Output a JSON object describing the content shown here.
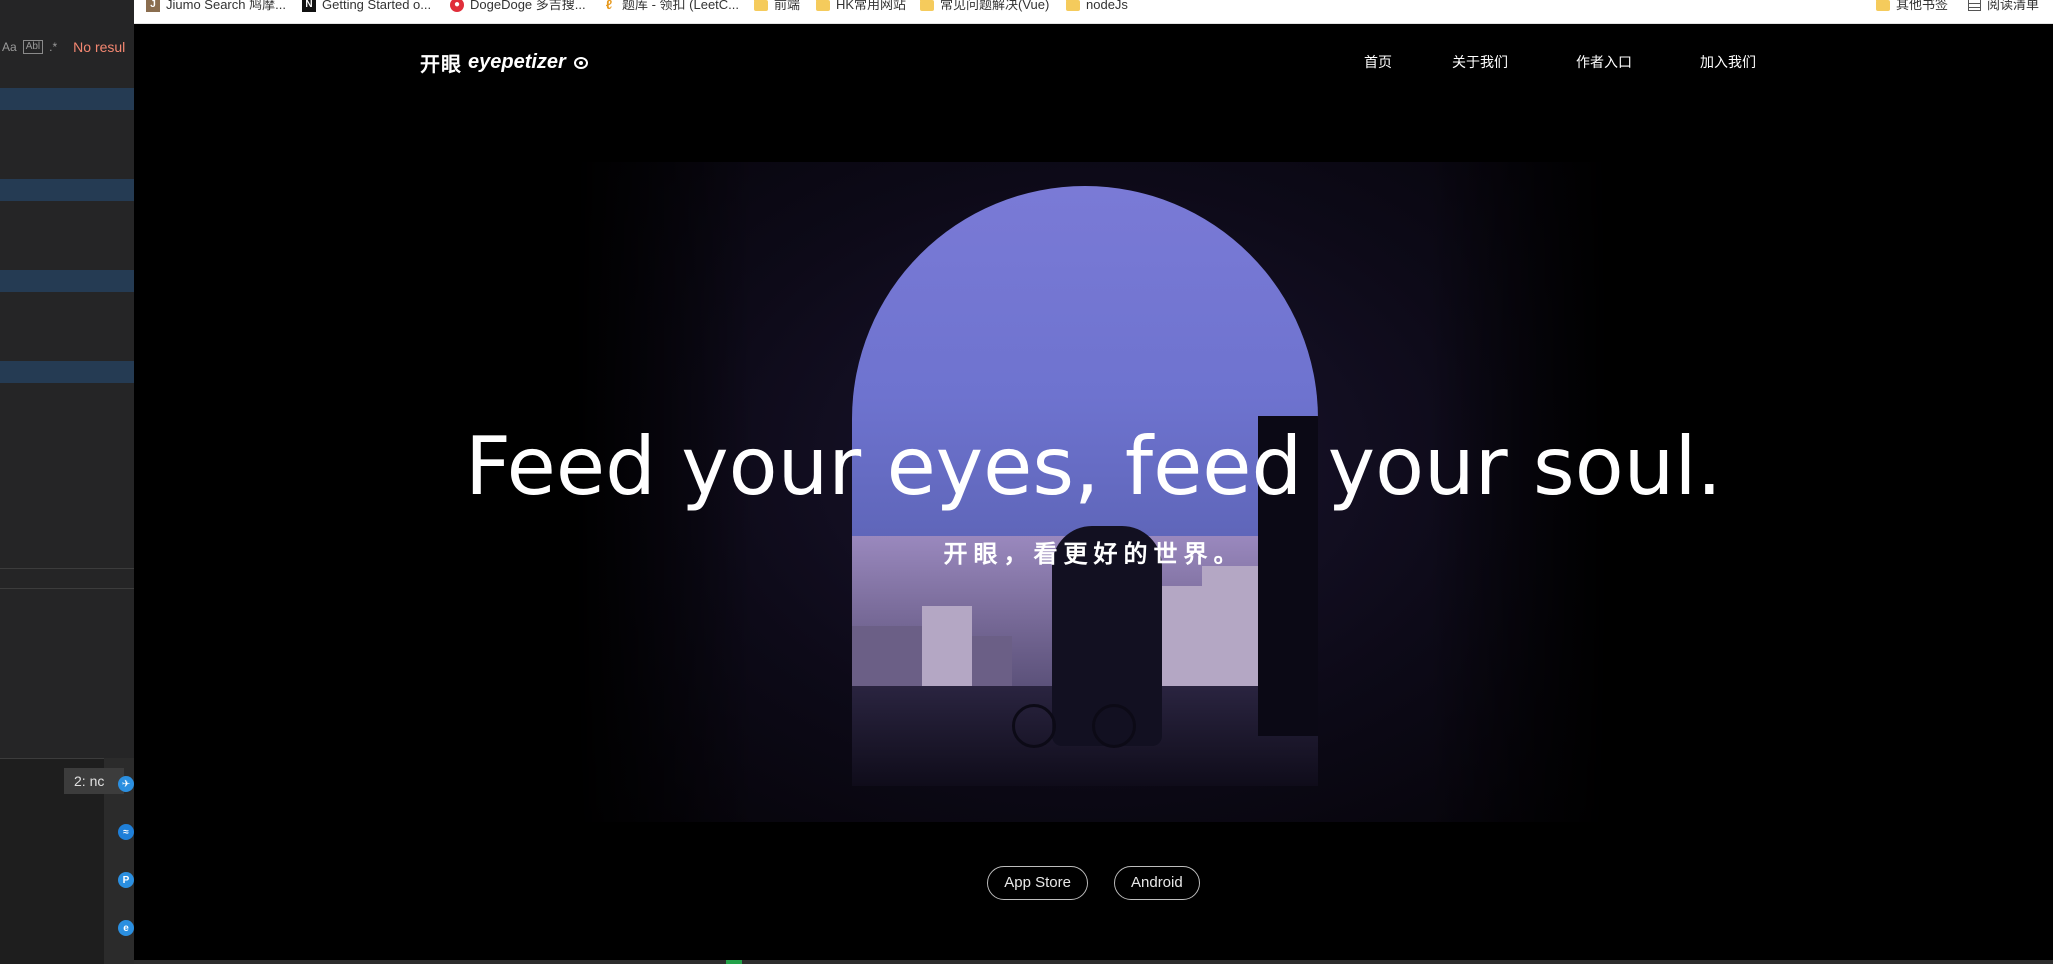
{
  "editor": {
    "find_options": [
      "Aa",
      "Abl",
      ".*"
    ],
    "no_results": "No resul",
    "terminal_select": "2: nc"
  },
  "bookmarks": [
    {
      "icon": "jiumo-icon",
      "label": "Jiumo Search 鸠摩..."
    },
    {
      "icon": "notion-icon",
      "label": "Getting Started o..."
    },
    {
      "icon": "dogedoge-icon",
      "label": "DogeDoge 多吉搜..."
    },
    {
      "icon": "leetcode-icon",
      "label": "题库 - 领扣 (LeetC..."
    },
    {
      "icon": "folder-icon",
      "label": "前端"
    },
    {
      "icon": "folder-icon",
      "label": "HK常用网站"
    },
    {
      "icon": "folder-icon",
      "label": "常见问题解决(Vue)"
    },
    {
      "icon": "folder-icon",
      "label": "nodeJs"
    }
  ],
  "bookmarks_right": [
    {
      "icon": "folder-icon",
      "label": "其他书签"
    },
    {
      "icon": "reading-list-icon",
      "label": "阅读清单"
    }
  ],
  "site": {
    "logo_cn": "开眼",
    "logo_en": "eyepetizer",
    "nav": [
      "首页",
      "关于我们",
      "作者入口",
      "加入我们"
    ],
    "headline": "Feed your eyes, feed your soul.",
    "subline": "开眼，看更好的世界。",
    "buttons": {
      "app_store": "App Store",
      "android": "Android"
    }
  },
  "colors": {
    "page_bg": "#000000",
    "editor_bg": "#252526",
    "no_results": "#f48771",
    "arch_sky": "#7a7ad6"
  }
}
